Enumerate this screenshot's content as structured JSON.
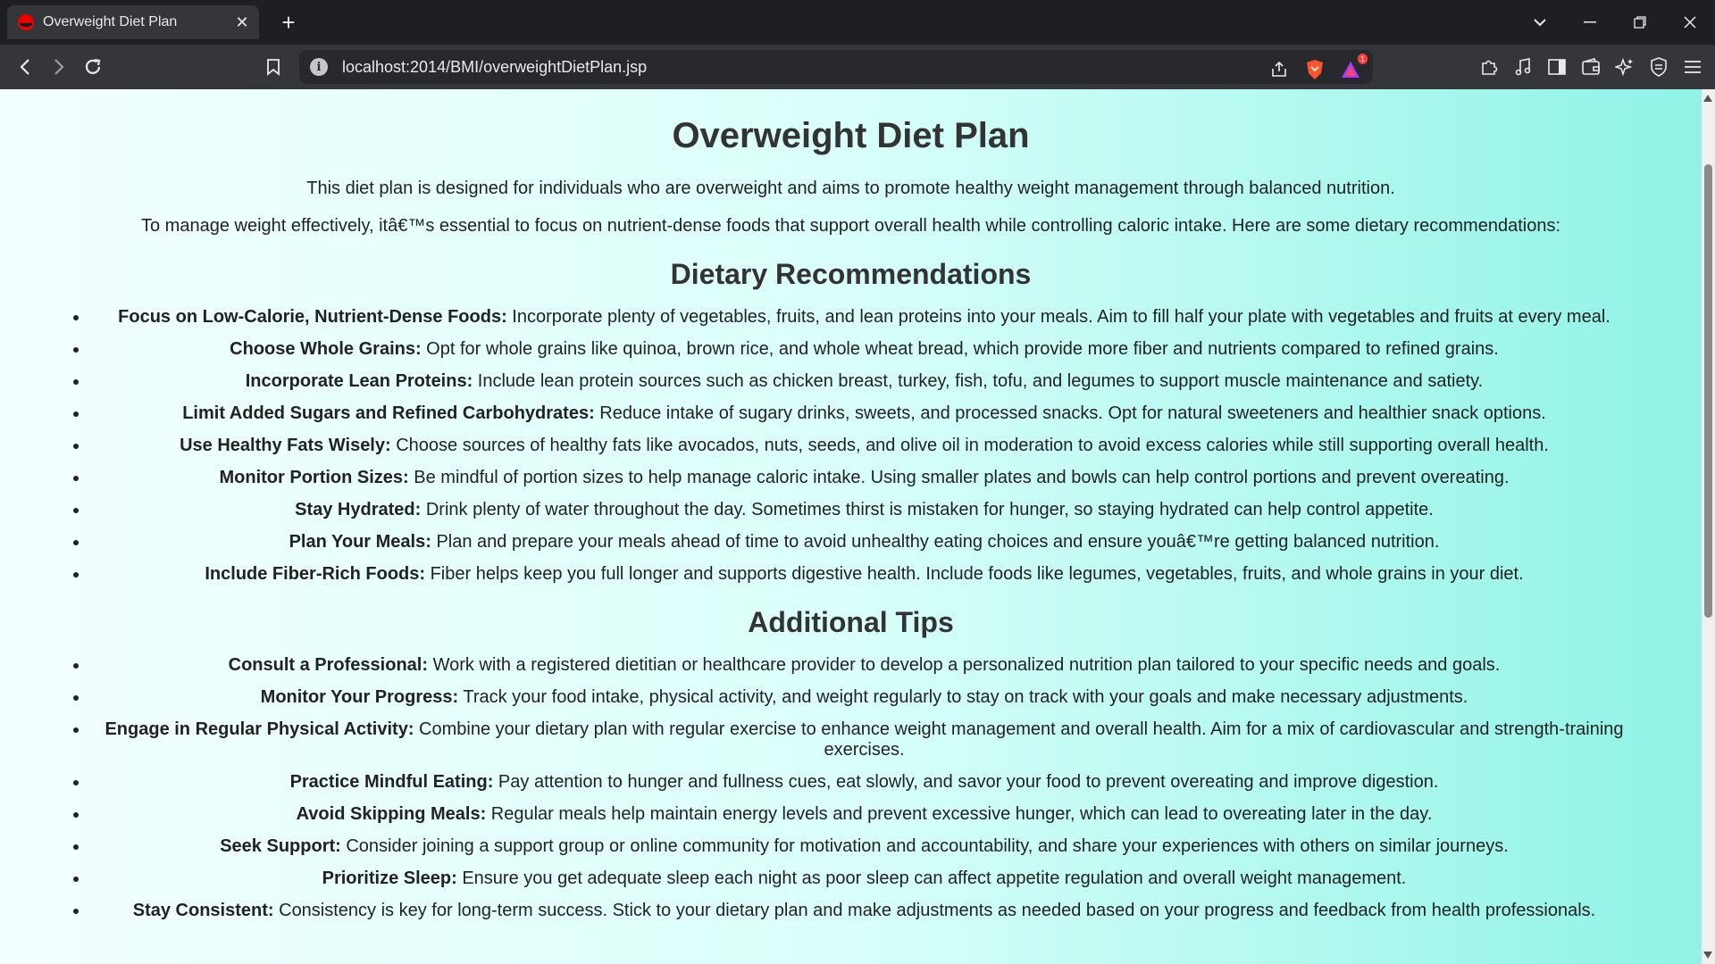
{
  "browser": {
    "tab_title": "Overweight Diet Plan",
    "tab_close": "✕",
    "new_tab": "+",
    "url": "localhost:2014/BMI/overweightDietPlan.jsp",
    "notification_count": "1"
  },
  "page": {
    "title": "Overweight Diet Plan",
    "intro": "This diet plan is designed for individuals who are overweight and aims to promote healthy weight management through balanced nutrition.",
    "intro2": "To manage weight effectively, itâ€™s essential to focus on nutrient-dense foods that support overall health while controlling caloric intake. Here are some dietary recommendations:",
    "recommendations_heading": "Dietary Recommendations",
    "recommendations": [
      {
        "label": "Focus on Low-Calorie, Nutrient-Dense Foods:",
        "text": " Incorporate plenty of vegetables, fruits, and lean proteins into your meals. Aim to fill half your plate with vegetables and fruits at every meal."
      },
      {
        "label": "Choose Whole Grains:",
        "text": " Opt for whole grains like quinoa, brown rice, and whole wheat bread, which provide more fiber and nutrients compared to refined grains."
      },
      {
        "label": "Incorporate Lean Proteins:",
        "text": " Include lean protein sources such as chicken breast, turkey, fish, tofu, and legumes to support muscle maintenance and satiety."
      },
      {
        "label": "Limit Added Sugars and Refined Carbohydrates:",
        "text": " Reduce intake of sugary drinks, sweets, and processed snacks. Opt for natural sweeteners and healthier snack options."
      },
      {
        "label": "Use Healthy Fats Wisely:",
        "text": " Choose sources of healthy fats like avocados, nuts, seeds, and olive oil in moderation to avoid excess calories while still supporting overall health."
      },
      {
        "label": "Monitor Portion Sizes:",
        "text": " Be mindful of portion sizes to help manage caloric intake. Using smaller plates and bowls can help control portions and prevent overeating."
      },
      {
        "label": "Stay Hydrated:",
        "text": " Drink plenty of water throughout the day. Sometimes thirst is mistaken for hunger, so staying hydrated can help control appetite."
      },
      {
        "label": "Plan Your Meals:",
        "text": " Plan and prepare your meals ahead of time to avoid unhealthy eating choices and ensure youâ€™re getting balanced nutrition."
      },
      {
        "label": "Include Fiber-Rich Foods:",
        "text": " Fiber helps keep you full longer and supports digestive health. Include foods like legumes, vegetables, fruits, and whole grains in your diet."
      }
    ],
    "tips_heading": "Additional Tips",
    "tips": [
      {
        "label": "Consult a Professional:",
        "text": " Work with a registered dietitian or healthcare provider to develop a personalized nutrition plan tailored to your specific needs and goals."
      },
      {
        "label": "Monitor Your Progress:",
        "text": " Track your food intake, physical activity, and weight regularly to stay on track with your goals and make necessary adjustments."
      },
      {
        "label": "Engage in Regular Physical Activity:",
        "text": " Combine your dietary plan with regular exercise to enhance weight management and overall health. Aim for a mix of cardiovascular and strength-training exercises."
      },
      {
        "label": "Practice Mindful Eating:",
        "text": " Pay attention to hunger and fullness cues, eat slowly, and savor your food to prevent overeating and improve digestion."
      },
      {
        "label": "Avoid Skipping Meals:",
        "text": " Regular meals help maintain energy levels and prevent excessive hunger, which can lead to overeating later in the day."
      },
      {
        "label": "Seek Support:",
        "text": " Consider joining a support group or online community for motivation and accountability, and share your experiences with others on similar journeys."
      },
      {
        "label": "Prioritize Sleep:",
        "text": " Ensure you get adequate sleep each night as poor sleep can affect appetite regulation and overall weight management."
      },
      {
        "label": "Stay Consistent:",
        "text": " Consistency is key for long-term success. Stick to your dietary plan and make adjustments as needed based on your progress and feedback from health professionals."
      }
    ]
  },
  "colors": {
    "chrome_dark": "#1f1f23",
    "chrome_toolbar": "#35363a",
    "page_gradient_start": "#f3fffe",
    "page_gradient_end": "#8ff3e6",
    "brave_orange": "#fb542b"
  }
}
